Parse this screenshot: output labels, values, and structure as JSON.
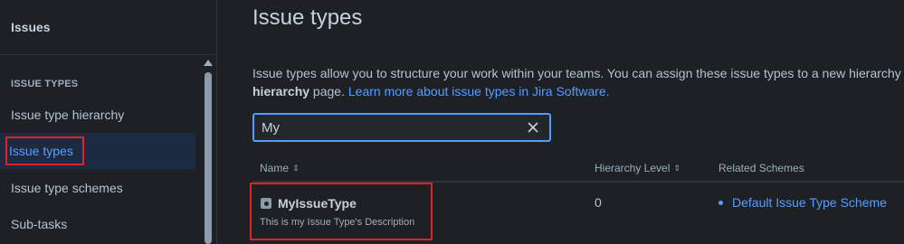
{
  "sidebar": {
    "header": "Issues",
    "section_title": "ISSUE TYPES",
    "items": [
      {
        "label": "Issue type hierarchy"
      },
      {
        "label": "Issue types"
      },
      {
        "label": "Issue type schemes"
      },
      {
        "label": "Sub-tasks"
      }
    ]
  },
  "main": {
    "title": "Issue types",
    "description": {
      "line1": "Issue types allow you to structure your work within your teams. You can assign these issue types to a new hierarchy",
      "bold": "hierarchy",
      "line2_rest": " page. ",
      "link": "Learn more about issue types in Jira Software."
    },
    "search": {
      "value": "My"
    },
    "table": {
      "headers": {
        "name": "Name",
        "hierarchy": "Hierarchy Level",
        "schemes": "Related Schemes"
      },
      "rows": [
        {
          "name": "MyIssueType",
          "description": "This is my Issue Type's Description",
          "hierarchy_level": "0",
          "scheme": "Default Issue Type Scheme"
        }
      ]
    }
  },
  "colors": {
    "accent": "#579dff",
    "highlight": "#e2202a",
    "background": "#1d2125"
  }
}
